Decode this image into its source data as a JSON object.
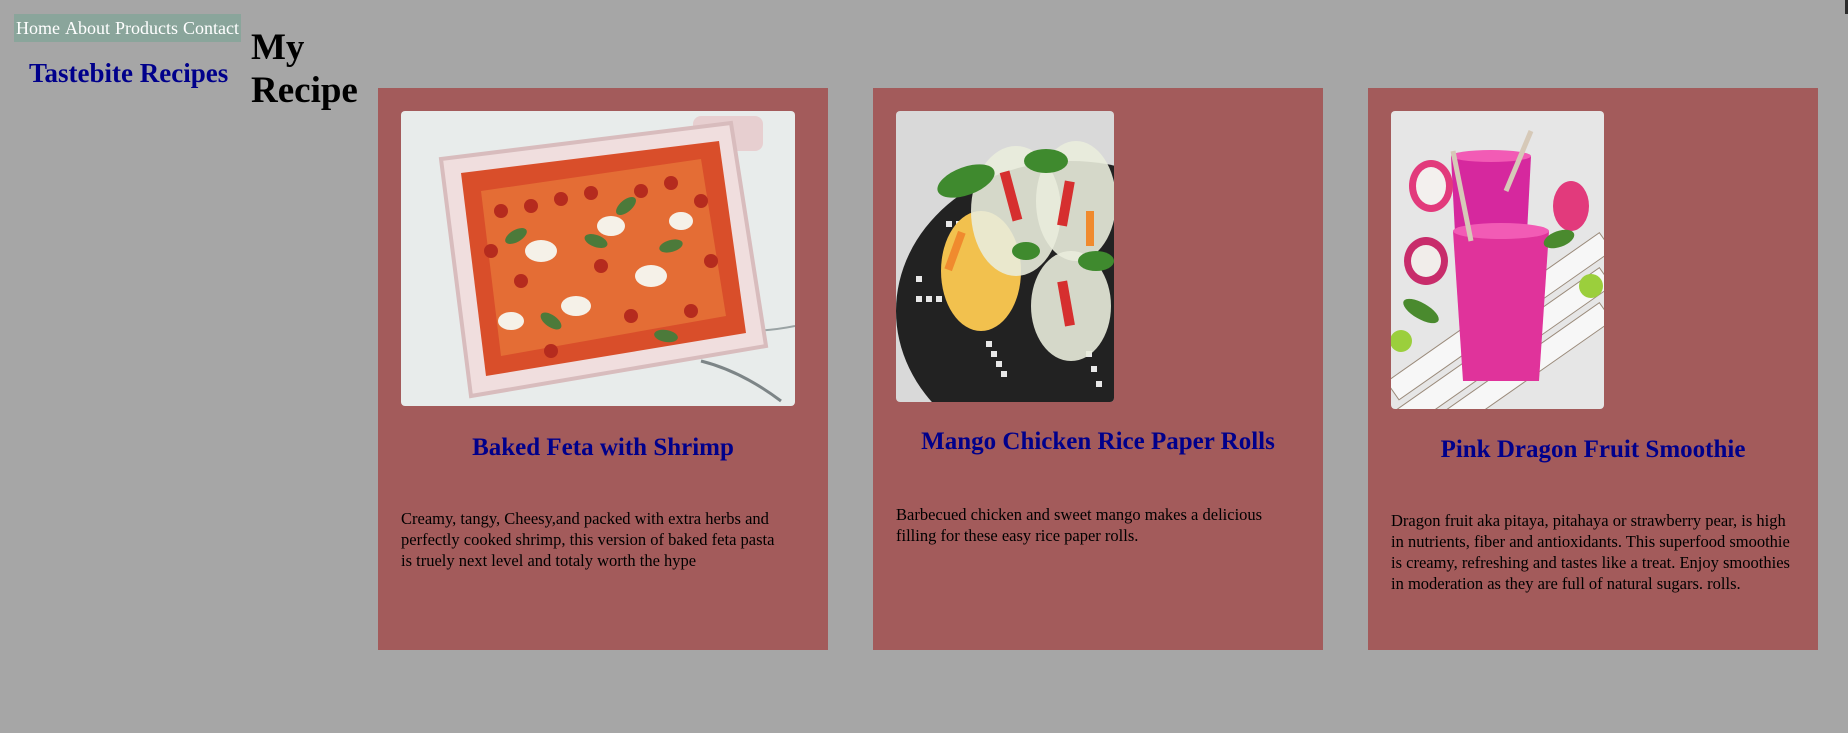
{
  "nav": {
    "items": [
      "Home",
      "About",
      "Products",
      "Contact"
    ]
  },
  "brand": {
    "name": "Tastebite Recipes"
  },
  "page": {
    "title": "My Recipe"
  },
  "recipes": [
    {
      "title": "Baked Feta with Shrimp",
      "description": "Creamy, tangy, Cheesy,and packed with extra herbs and perfectly cooked shrimp, this version of baked feta pasta is truely next level and totaly worth the hype",
      "image_icon": "baked-feta-dish-image"
    },
    {
      "title": "Mango Chicken Rice Paper Rolls",
      "description": "Barbecued chicken and sweet mango makes a delicious filling for these easy rice paper rolls.",
      "image_icon": "rice-paper-rolls-image"
    },
    {
      "title": "Pink Dragon Fruit Smoothie",
      "description": "Dragon fruit aka pitaya, pitahaya or strawberry pear, is high in nutrients, fiber and antioxidants. This superfood smoothie is creamy, refreshing and tastes like a treat. Enjoy smoothies in moderation as they are full of natural sugars. rolls.",
      "image_icon": "dragon-fruit-smoothie-image"
    }
  ],
  "colors": {
    "background": "#a6a6a6",
    "nav_background": "#8aa59b",
    "card_background": "#a35b5b",
    "heading_blue": "#00008b"
  }
}
